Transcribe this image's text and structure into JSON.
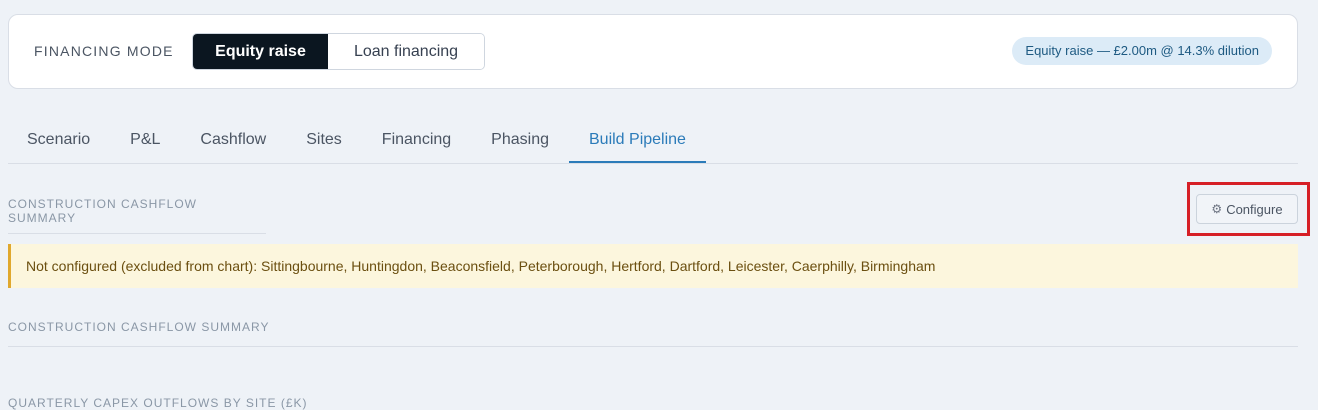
{
  "financing": {
    "label": "FINANCING MODE",
    "options": [
      "Equity raise",
      "Loan financing"
    ],
    "selected": "Equity raise",
    "status": "Equity raise — £2.00m @ 14.3% dilution"
  },
  "tabs": [
    "Scenario",
    "P&L",
    "Cashflow",
    "Sites",
    "Financing",
    "Phasing",
    "Build Pipeline"
  ],
  "active_tab": "Build Pipeline",
  "sections": [
    "CONSTRUCTION CASHFLOW SUMMARY",
    "CONSTRUCTION CASHFLOW SUMMARY",
    "QUARTERLY CAPEX OUTFLOWS BY SITE (£K)"
  ],
  "configure": {
    "label": "Configure",
    "icon": "gear-icon"
  },
  "warning": "Not configured (excluded from chart): Sittingbourne, Huntingdon, Beaconsfield, Peterborough, Hertford, Dartford, Leicester, Caerphilly, Birmingham",
  "colors": {
    "accent": "#2b7bb9",
    "active_segment": "#0b1620",
    "highlight": "#d61f26",
    "warning_bg": "#fcf6dd",
    "warning_border": "#e0a82e"
  }
}
